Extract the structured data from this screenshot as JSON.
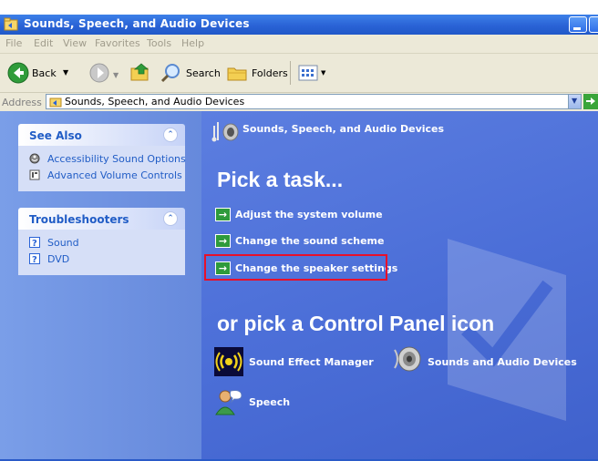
{
  "window": {
    "title": "Sounds, Speech, and Audio Devices",
    "icon": "control-panel-folder-icon"
  },
  "menu": [
    "File",
    "Edit",
    "View",
    "Favorites",
    "Tools",
    "Help"
  ],
  "toolbar": {
    "back_label": "Back",
    "search_label": "Search",
    "folders_label": "Folders"
  },
  "address": {
    "label": "Address",
    "value": "Sounds, Speech, and Audio Devices"
  },
  "sidebar": {
    "see_also": {
      "title": "See Also",
      "items": [
        {
          "label": "Accessibility Sound Options",
          "icon": "accessibility-icon"
        },
        {
          "label": "Advanced Volume Controls",
          "icon": "help-book-icon"
        }
      ]
    },
    "troubleshooters": {
      "title": "Troubleshooters",
      "items": [
        {
          "label": "Sound",
          "icon": "help-icon"
        },
        {
          "label": "DVD",
          "icon": "help-icon"
        }
      ]
    }
  },
  "main": {
    "header": "Sounds, Speech, and Audio Devices",
    "pick_task": "Pick a task...",
    "tasks": [
      {
        "label": "Adjust the system volume"
      },
      {
        "label": "Change the sound scheme"
      },
      {
        "label": "Change the speaker settings"
      }
    ],
    "or_pick": "or pick a Control Panel icon",
    "icons": [
      {
        "label": "Sound Effect Manager",
        "icon": "sound-effect-manager-icon"
      },
      {
        "label": "Sounds and Audio Devices",
        "icon": "speaker-icon"
      },
      {
        "label": "Speech",
        "icon": "speech-icon"
      }
    ]
  },
  "colors": {
    "titlebar": "#2a63d6",
    "task_pane": "#4c6fd8",
    "sidebar": "#6f93e2",
    "highlight": "#e8102a"
  }
}
